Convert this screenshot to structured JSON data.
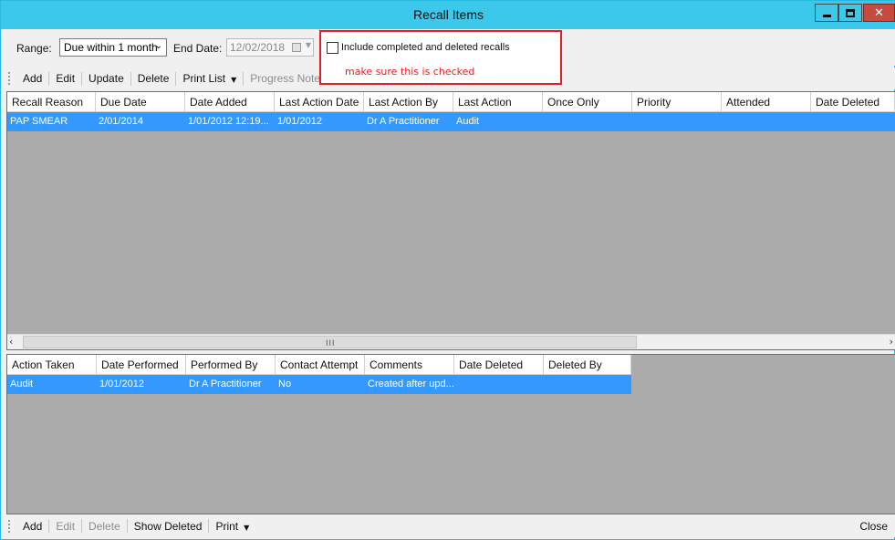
{
  "window": {
    "title": "Recall Items",
    "close_glyph": "✕"
  },
  "filters": {
    "range_label": "Range:",
    "range_value": "Due within 1 month",
    "end_date_label": "End Date:",
    "end_date_value": "12/02/2018",
    "include_label": "Include completed and deleted recalls",
    "include_checked": false,
    "annotation": "make sure this is checked"
  },
  "top_toolbar": {
    "add": "Add",
    "edit": "Edit",
    "update": "Update",
    "delete": "Delete",
    "print_list": "Print List",
    "progress_notes": "Progress Notes"
  },
  "recall_grid": {
    "columns": [
      "Recall Reason",
      "Due Date",
      "Date Added",
      "Last Action Date",
      "Last Action By",
      "Last Action",
      "Once Only",
      "Priority",
      "Attended",
      "Date Deleted"
    ],
    "rows": [
      [
        "PAP SMEAR",
        "2/01/2014",
        "1/01/2012 12:19...",
        "1/01/2012",
        "Dr A Practitioner",
        "Audit",
        "",
        "",
        "",
        ""
      ]
    ],
    "scroll_grip": "III"
  },
  "action_grid": {
    "columns": [
      "Action Taken",
      "Date Performed",
      "Performed By",
      "Contact Attempt",
      "Comments",
      "Date Deleted",
      "Deleted By"
    ],
    "rows": [
      [
        "Audit",
        "1/01/2012",
        "Dr A Practitioner",
        "No",
        "Created after upd...",
        "",
        ""
      ]
    ]
  },
  "bottom_toolbar": {
    "add": "Add",
    "edit": "Edit",
    "delete": "Delete",
    "show_deleted": "Show Deleted",
    "print": "Print",
    "close": "Close"
  },
  "colors": {
    "titlebar": "#3cc8eb",
    "selection": "#3399ff",
    "grid_background": "#ababab",
    "annotation": "#e21f26"
  }
}
